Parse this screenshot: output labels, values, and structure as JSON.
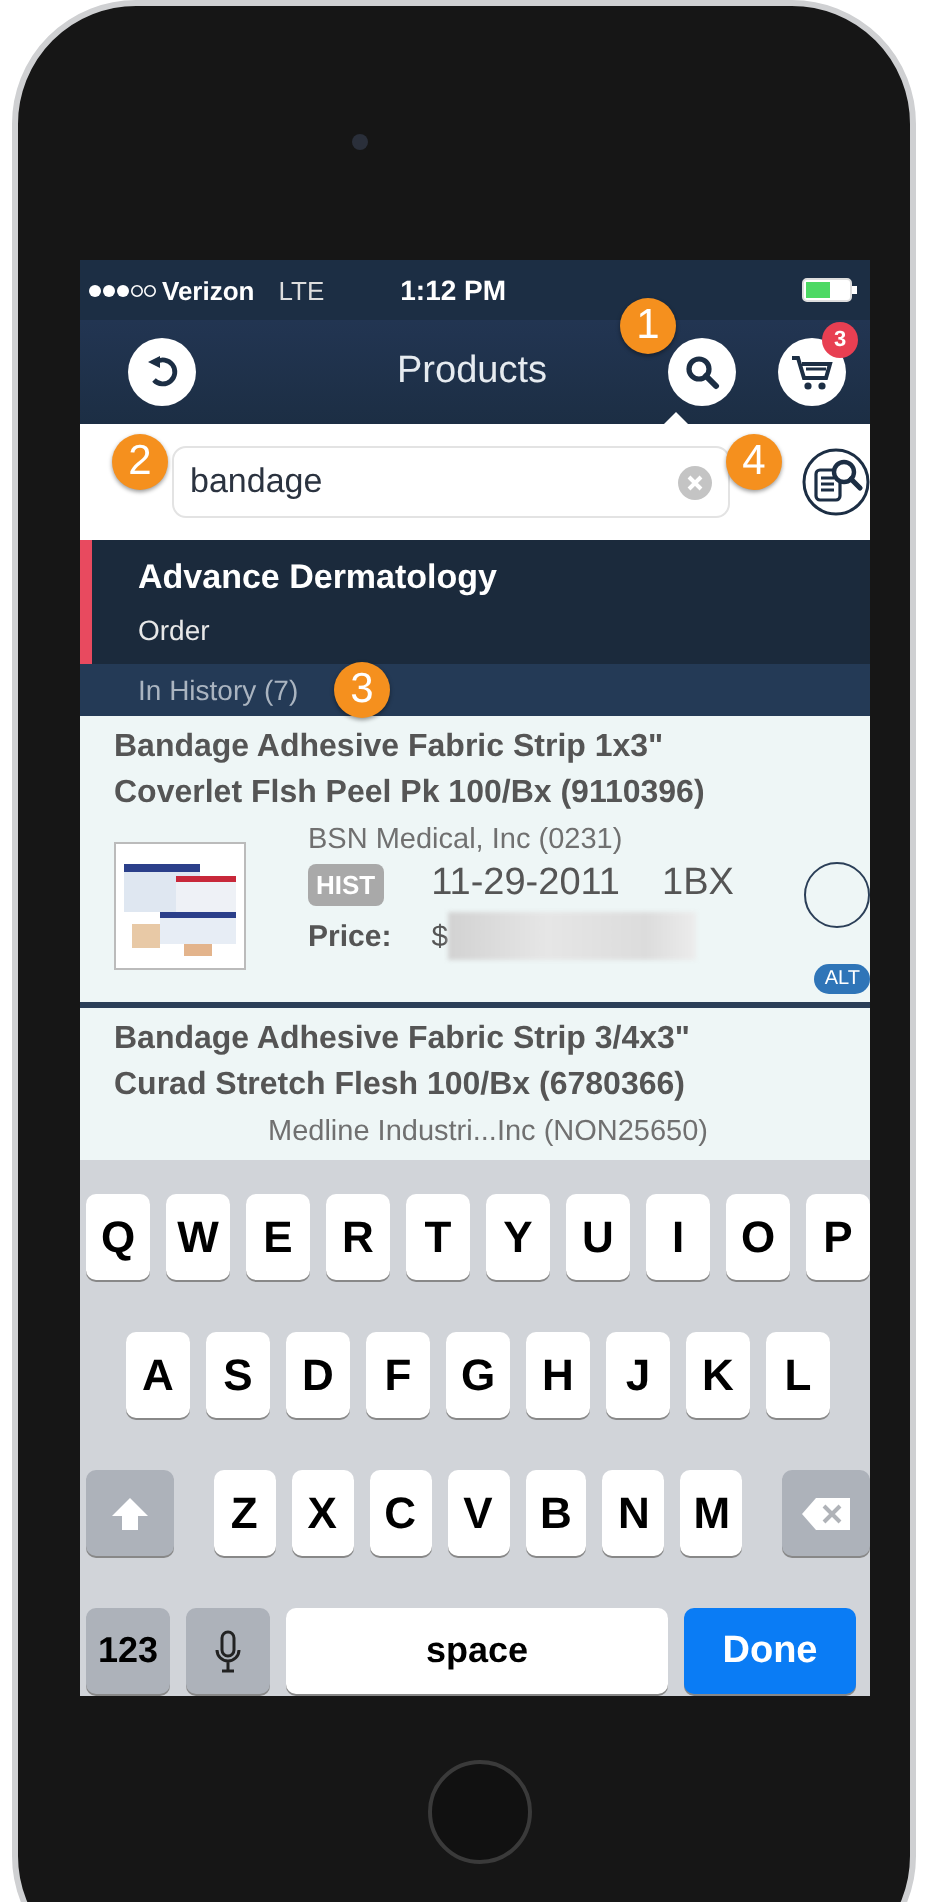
{
  "status_bar": {
    "carrier": "Verizon",
    "network": "LTE",
    "time": "1:12 PM"
  },
  "nav": {
    "title": "Products",
    "cart_count": "3"
  },
  "search": {
    "value": "bandage"
  },
  "account": {
    "name": "Advance Dermatology",
    "mode": "Order"
  },
  "section": {
    "label": "In History (7)"
  },
  "products": [
    {
      "kind": "full",
      "title": "Bandage Adhesive Fabric Strip 1x3\" Coverlet Flsh Peel Pk 100/Bx (9110396)",
      "supplier": "BSN Medical, Inc (0231)",
      "badge": "HIST",
      "date": "11-29-2011",
      "qty": "1BX",
      "price_label": "Price:",
      "price_prefix": "$",
      "alt": "ALT",
      "selected": false
    },
    {
      "kind": "partial",
      "title": "Bandage Adhesive Fabric Strip 3/4x3\" Curad Stretch Flesh 100/Bx (6780366)",
      "supplier": "Medline Industri...Inc (NON25650)"
    }
  ],
  "keyboard": {
    "rows": [
      [
        "Q",
        "W",
        "E",
        "R",
        "T",
        "Y",
        "U",
        "I",
        "O",
        "P"
      ],
      [
        "A",
        "S",
        "D",
        "F",
        "G",
        "H",
        "J",
        "K",
        "L"
      ],
      [
        "Z",
        "X",
        "C",
        "V",
        "B",
        "N",
        "M"
      ]
    ],
    "numbers": "123",
    "space": "space",
    "done": "Done"
  },
  "callouts": [
    "1",
    "2",
    "3",
    "4"
  ]
}
